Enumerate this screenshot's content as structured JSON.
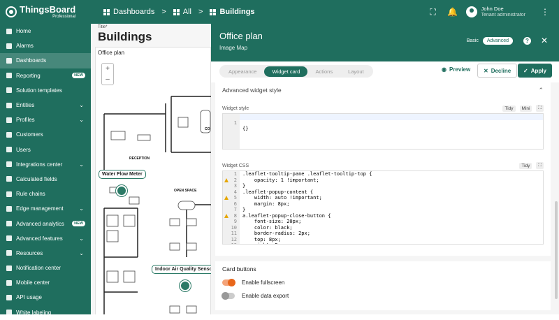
{
  "app": {
    "name": "ThingsBoard",
    "edition": "Professional"
  },
  "breadcrumb": [
    {
      "label": "Dashboards"
    },
    {
      "label": "All"
    },
    {
      "label": "Buildings"
    }
  ],
  "user": {
    "name": "John Doe",
    "role": "Tenant administrator"
  },
  "sidebar": {
    "items": [
      {
        "label": "Home",
        "icon": "home-icon"
      },
      {
        "label": "Alarms",
        "icon": "bell-icon"
      },
      {
        "label": "Dashboards",
        "icon": "dashboard-icon",
        "active": true
      },
      {
        "label": "Reporting",
        "icon": "report-icon",
        "badge": "NEW"
      },
      {
        "label": "Solution templates",
        "icon": "template-icon"
      },
      {
        "label": "Entities",
        "icon": "entities-icon",
        "expand": true
      },
      {
        "label": "Profiles",
        "icon": "profiles-icon",
        "expand": true
      },
      {
        "label": "Customers",
        "icon": "customers-icon"
      },
      {
        "label": "Users",
        "icon": "users-icon"
      },
      {
        "label": "Integrations center",
        "icon": "integrations-icon",
        "expand": true
      },
      {
        "label": "Calculated fields",
        "icon": "calc-icon"
      },
      {
        "label": "Rule chains",
        "icon": "rule-chain-icon"
      },
      {
        "label": "Edge management",
        "icon": "edge-icon",
        "expand": true
      },
      {
        "label": "Advanced analytics",
        "icon": "analytics-icon",
        "badge": "NEW"
      },
      {
        "label": "Advanced features",
        "icon": "features-icon",
        "expand": true
      },
      {
        "label": "Resources",
        "icon": "resources-icon",
        "expand": true
      },
      {
        "label": "Notification center",
        "icon": "notification-icon"
      },
      {
        "label": "Mobile center",
        "icon": "mobile-icon"
      },
      {
        "label": "API usage",
        "icon": "api-icon"
      },
      {
        "label": "White labeling",
        "icon": "white-label-icon"
      }
    ]
  },
  "dashboard": {
    "title_label": "Title*",
    "title": "Buildings",
    "widget_title": "Office plan",
    "zoom_in": "+",
    "zoom_out": "–",
    "markers": [
      {
        "label": "Water Flow Meter"
      },
      {
        "label": "Indoor Air Quality Sensor"
      }
    ],
    "rooms": [
      "RECEPTION",
      "OPEN SPACE",
      "CO"
    ]
  },
  "panel": {
    "title": "Office plan",
    "subtitle": "Image Map",
    "mode_basic": "Basic",
    "mode_advanced": "Advanced",
    "tabs": [
      {
        "label": "Appearance"
      },
      {
        "label": "Widget card",
        "active": true
      },
      {
        "label": "Actions"
      },
      {
        "label": "Layout"
      }
    ],
    "preview": "Preview",
    "decline": "Decline",
    "apply": "Apply"
  },
  "advanced_style": {
    "header": "Advanced widget style",
    "widget_style_label": "Widget style",
    "tidy": "Tidy",
    "mini": "Mini",
    "widget_style_code": [
      {
        "n": "1",
        "text": "{}"
      }
    ],
    "widget_css_label": "Widget CSS",
    "css_lines": [
      {
        "n": "1",
        "text": ".leaflet-tooltip-pane .leaflet-tooltip-top {",
        "fold": true
      },
      {
        "n": "2",
        "text": "    opacity: 1 !important;",
        "warn": true
      },
      {
        "n": "3",
        "text": "}"
      },
      {
        "n": "4",
        "text": ".leaflet-popup-content {",
        "fold": true
      },
      {
        "n": "5",
        "text": "    width: auto !important;",
        "warn": true
      },
      {
        "n": "6",
        "text": "    margin: 8px;"
      },
      {
        "n": "7",
        "text": "}"
      },
      {
        "n": "8",
        "text": "a.leaflet-popup-close-button {",
        "fold": true,
        "warn": true
      },
      {
        "n": "9",
        "text": "    font-size: 20px;"
      },
      {
        "n": "10",
        "text": "    color: black;"
      },
      {
        "n": "11",
        "text": "    border-radius: 2px;"
      },
      {
        "n": "12",
        "text": "    top: 8px;"
      },
      {
        "n": "13",
        "text": "    right: 5px;"
      }
    ]
  },
  "card_buttons": {
    "title": "Card buttons",
    "fullscreen": "Enable fullscreen",
    "data_export": "Enable data export"
  }
}
